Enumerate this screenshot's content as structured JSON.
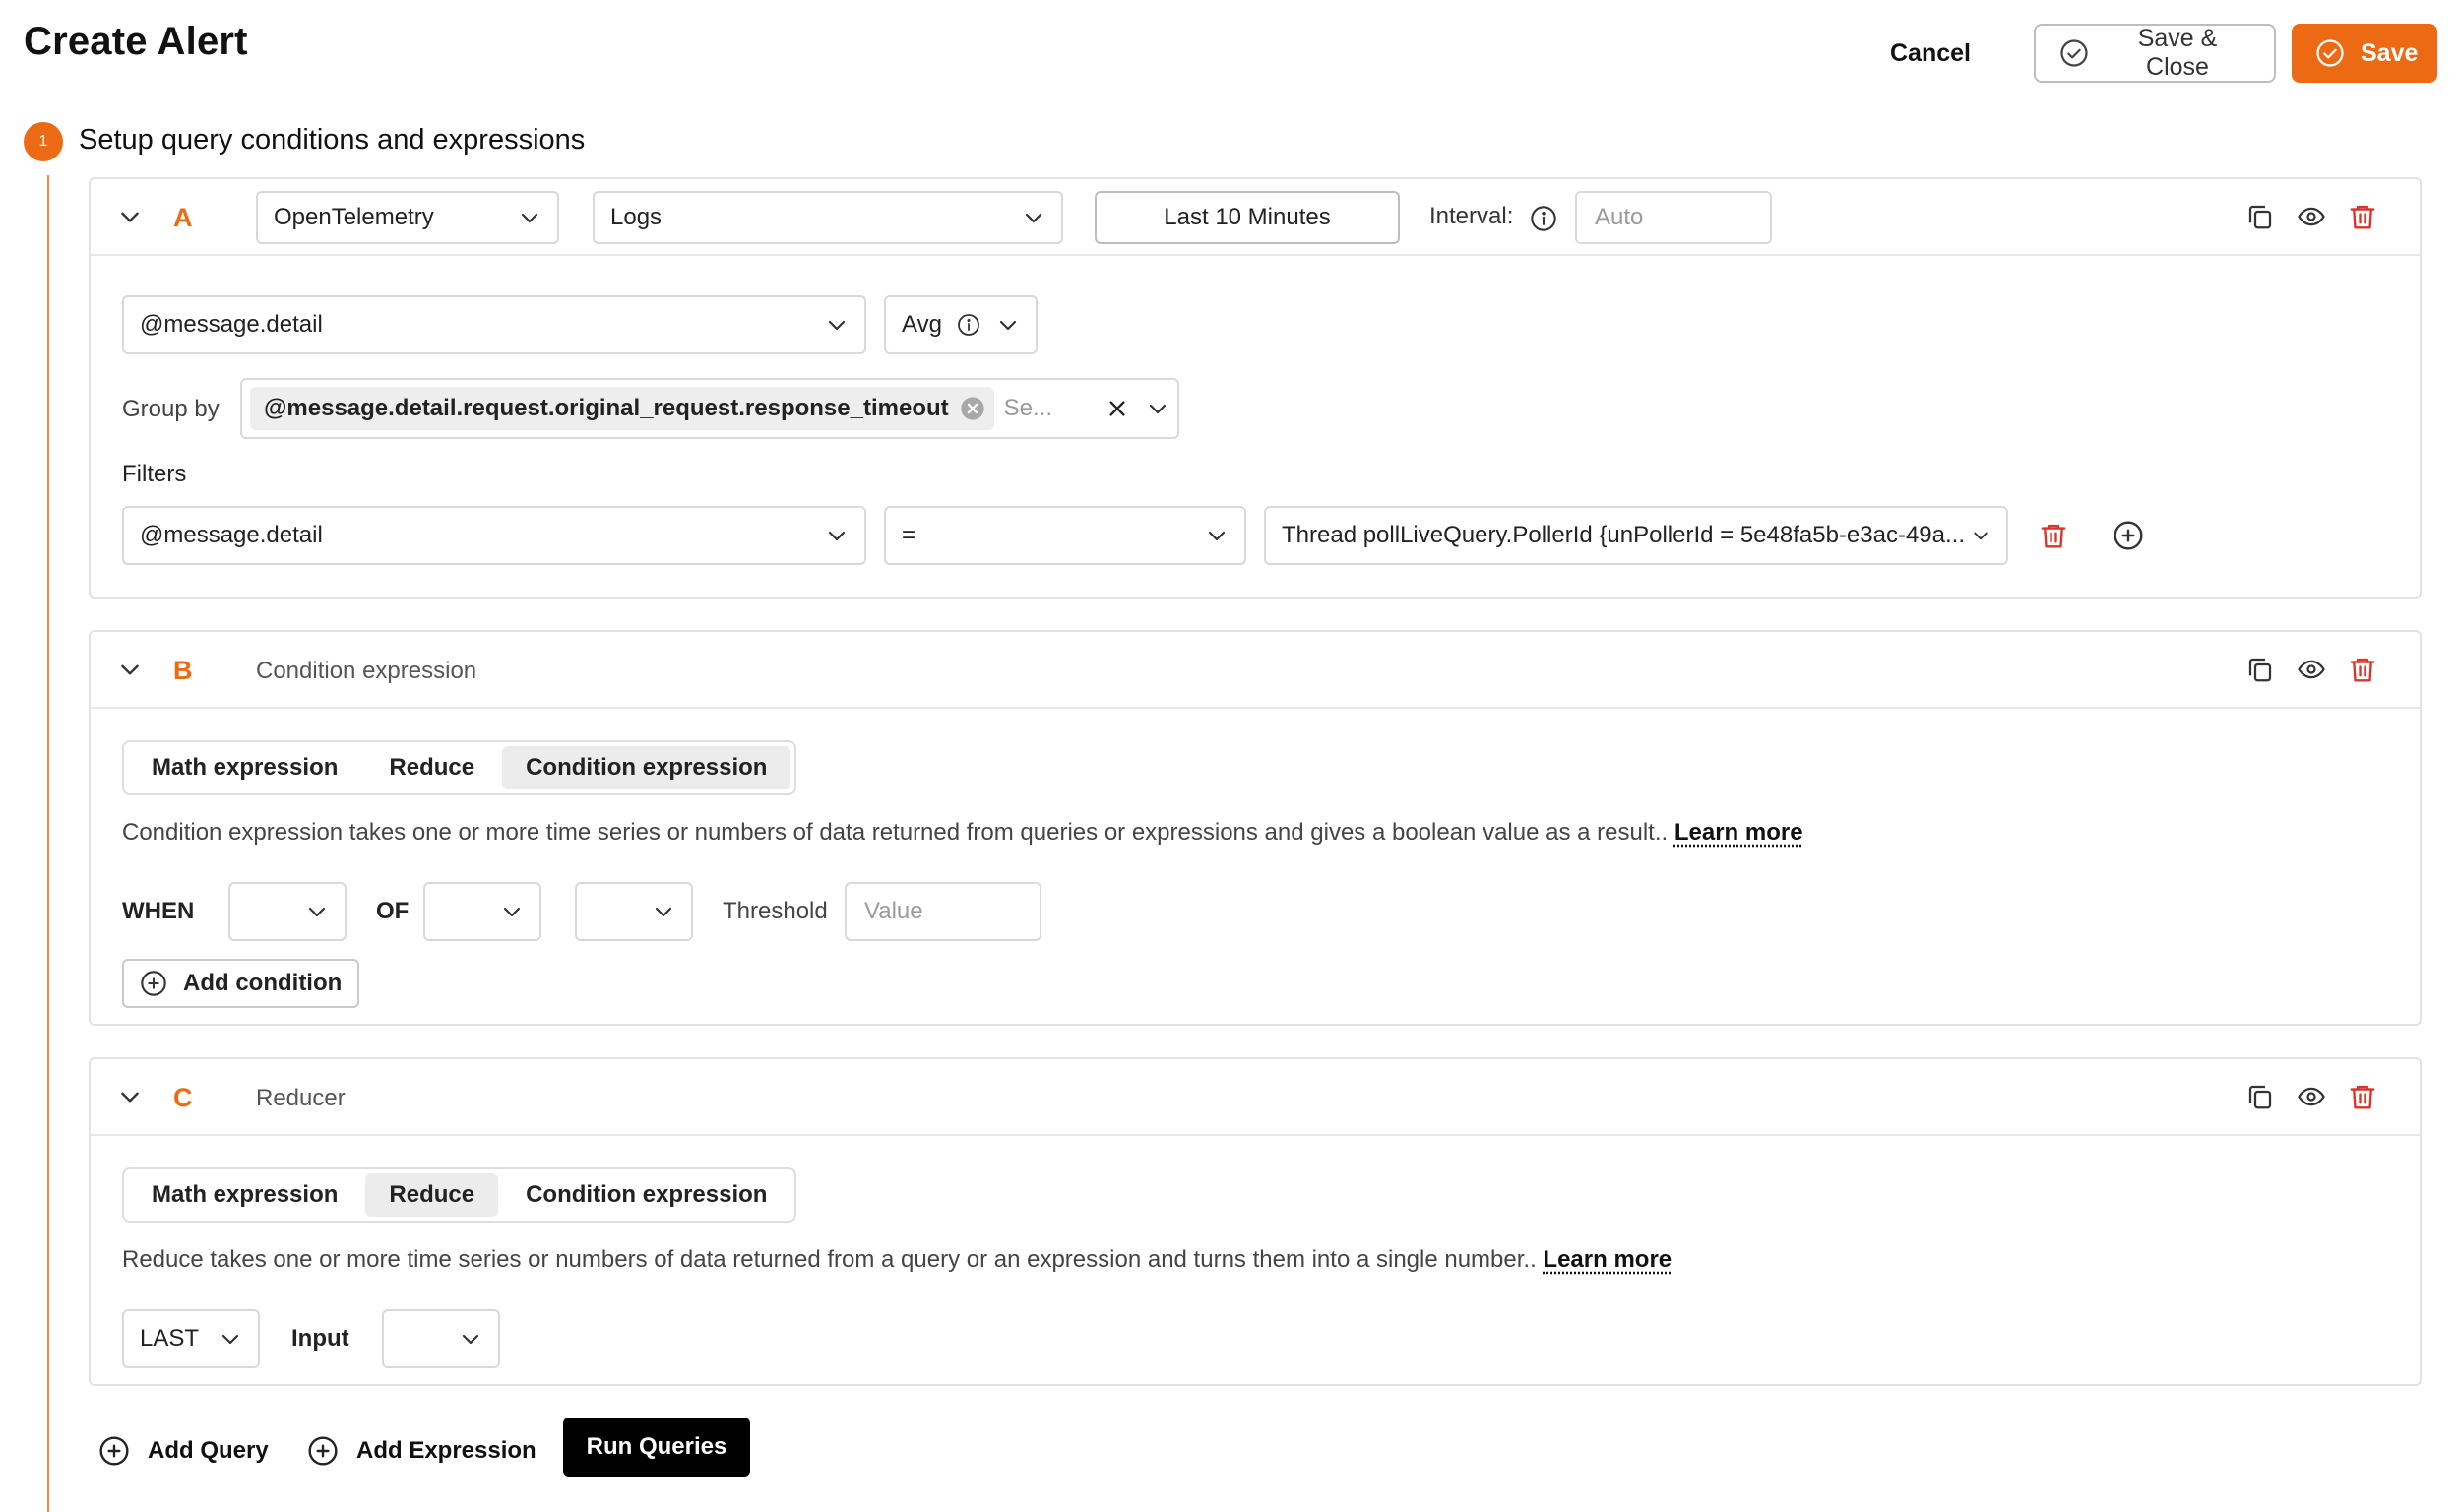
{
  "header": {
    "title": "Create Alert",
    "cancel_label": "Cancel",
    "save_close_label": "Save & Close",
    "save_label": "Save"
  },
  "step": {
    "number": "1",
    "title": "Setup query conditions and expressions"
  },
  "colors": {
    "accent": "#ec6a13",
    "danger": "#d9352b",
    "timeline": "#ec8a4a"
  },
  "query_a": {
    "letter": "A",
    "datasource": "OpenTelemetry",
    "type": "Logs",
    "time_range": "Last 10 Minutes",
    "interval_label": "Interval:",
    "interval_placeholder": "Auto",
    "field": "@message.detail",
    "aggregation": "Avg",
    "group_by_label": "Group by",
    "group_by_chip": "@message.detail.request.original_request.response_timeout",
    "group_by_search_placeholder": "Se...",
    "filters_label": "Filters",
    "filter": {
      "field": "@message.detail",
      "operator": "=",
      "value": "Thread pollLiveQuery.PollerId {unPollerId = 5e48fa5b-e3ac-49a..."
    }
  },
  "expression_b": {
    "letter": "B",
    "name": "Condition expression",
    "tabs": [
      "Math expression",
      "Reduce",
      "Condition expression"
    ],
    "active_tab": "Condition expression",
    "description": "Condition expression takes one or more time series or numbers of data returned from queries or expressions and gives a boolean value as a result..",
    "learn_more": "Learn more",
    "when_label": "WHEN",
    "of_label": "OF",
    "threshold_label": "Threshold",
    "threshold_placeholder": "Value",
    "add_condition_label": "Add condition"
  },
  "expression_c": {
    "letter": "C",
    "name": "Reducer",
    "tabs": [
      "Math expression",
      "Reduce",
      "Condition expression"
    ],
    "active_tab": "Reduce",
    "description": "Reduce takes one or more time series or numbers of data returned from a query or an expression and turns them into a single number..",
    "learn_more": "Learn more",
    "function": "LAST",
    "input_label": "Input"
  },
  "footer": {
    "add_query_label": "Add Query",
    "add_expression_label": "Add Expression",
    "run_queries_label": "Run Queries"
  },
  "icons": [
    "chevron-down-icon",
    "info-icon",
    "copy-icon",
    "eye-icon",
    "trash-icon",
    "plus-circle-icon",
    "check-circle-icon",
    "close-icon",
    "clear-circle-icon"
  ]
}
